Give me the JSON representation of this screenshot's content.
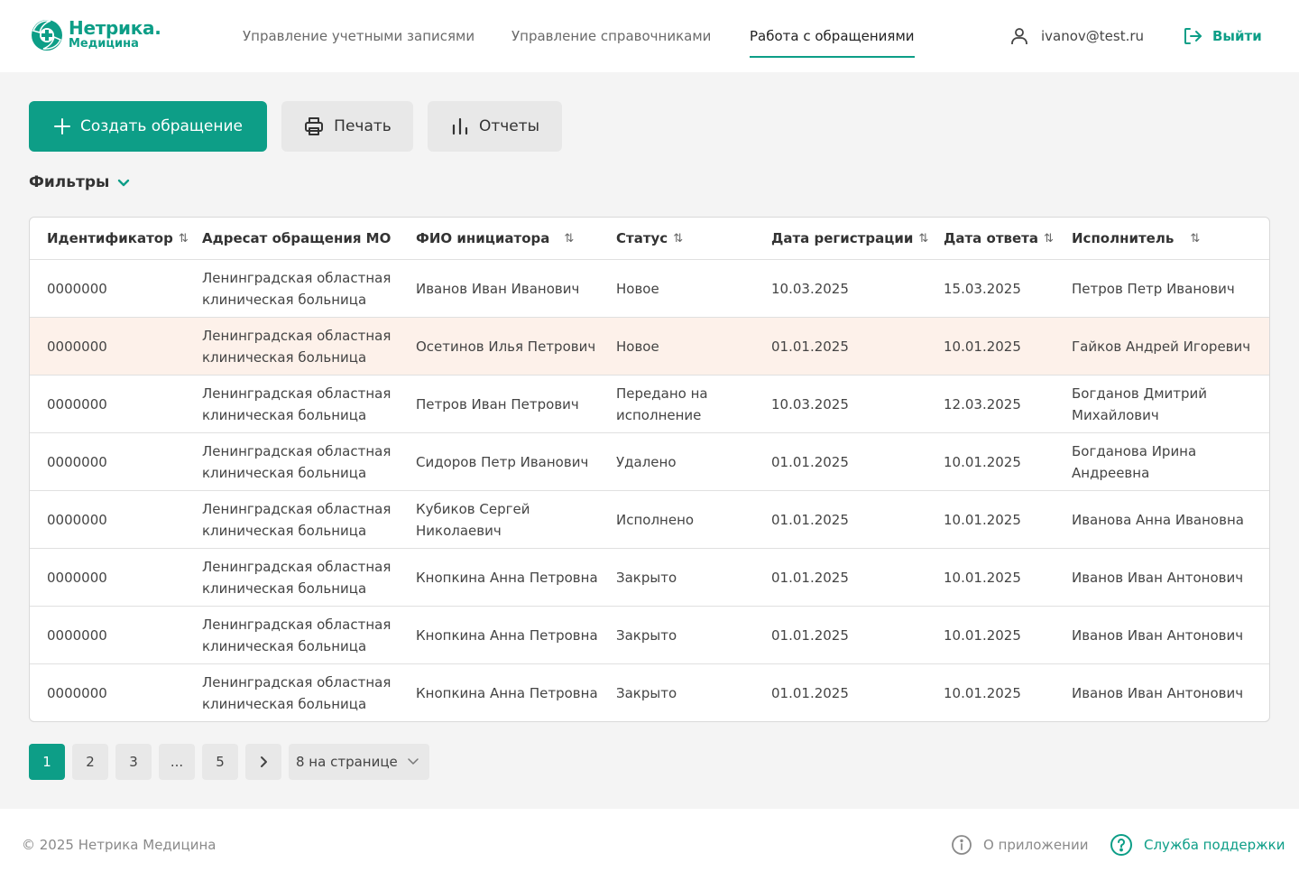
{
  "colors": {
    "accent": "#0d9e87",
    "highlight_row": "#fdf1ea"
  },
  "brand": {
    "title": "Нетрика.",
    "subtitle": "Медицина"
  },
  "nav": [
    {
      "label": "Управление учетными записями"
    },
    {
      "label": "Управление справочниками"
    },
    {
      "label": "Работа с обращениями"
    }
  ],
  "user": {
    "email": "ivanov@test.ru",
    "icon": "user-icon"
  },
  "logout": {
    "label": "Выйти",
    "icon": "logout-icon"
  },
  "toolbar": {
    "create_label": "Создать обращение",
    "print_label": "Печать",
    "reports_label": "Отчеты"
  },
  "filters": {
    "label": "Фильтры"
  },
  "table": {
    "columns": [
      {
        "label": "Идентификатор",
        "sortable": true
      },
      {
        "label": "Адресат обращения МО",
        "sortable": false
      },
      {
        "label": "ФИО инициатора",
        "sortable": true
      },
      {
        "label": "Статус",
        "sortable": true
      },
      {
        "label": "Дата регистрации",
        "sortable": true
      },
      {
        "label": "Дата ответа",
        "sortable": true
      },
      {
        "label": "Исполнитель",
        "sortable": true
      }
    ],
    "rows": [
      [
        "0000000",
        "Ленинградская областная клиническая больница",
        "Иванов Иван Иванович",
        "Новое",
        "10.03.2025",
        "15.03.2025",
        "Петров Петр Иванович"
      ],
      [
        "0000000",
        "Ленинградская областная клиническая больница",
        "Осетинов Илья Петрович",
        "Новое",
        "01.01.2025",
        "10.01.2025",
        "Гайков Андрей Игоревич"
      ],
      [
        "0000000",
        "Ленинградская областная клиническая больница",
        "Петров Иван Петрович",
        "Передано на исполнение",
        "10.03.2025",
        "12.03.2025",
        "Богданов Дмитрий Михайлович"
      ],
      [
        "0000000",
        "Ленинградская областная клиническая больница",
        "Сидоров Петр Иванович",
        "Удалено",
        "01.01.2025",
        "10.01.2025",
        "Богданова Ирина Андреевна"
      ],
      [
        "0000000",
        "Ленинградская областная клиническая больница",
        "Кубиков Сергей Николаевич",
        "Исполнено",
        "01.01.2025",
        "10.01.2025",
        "Иванова Анна Ивановна"
      ],
      [
        "0000000",
        "Ленинградская областная клиническая больница",
        "Кнопкина Анна Петровна",
        "Закрыто",
        "01.01.2025",
        "10.01.2025",
        "Иванов Иван Антонович"
      ],
      [
        "0000000",
        "Ленинградская областная клиническая больница",
        "Кнопкина Анна Петровна",
        "Закрыто",
        "01.01.2025",
        "10.01.2025",
        "Иванов Иван Антонович"
      ],
      [
        "0000000",
        "Ленинградская областная клиническая больница",
        "Кнопкина Анна Петровна",
        "Закрыто",
        "01.01.2025",
        "10.01.2025",
        "Иванов Иван Антонович"
      ]
    ]
  },
  "pagination": {
    "pages": [
      "1",
      "2",
      "3",
      "...",
      "5"
    ],
    "current": "1",
    "per_page": "8 на странице"
  },
  "footer": {
    "copyright": "© 2025 Нетрика Медицина",
    "about": "О приложении",
    "support": "Служба поддержки"
  }
}
